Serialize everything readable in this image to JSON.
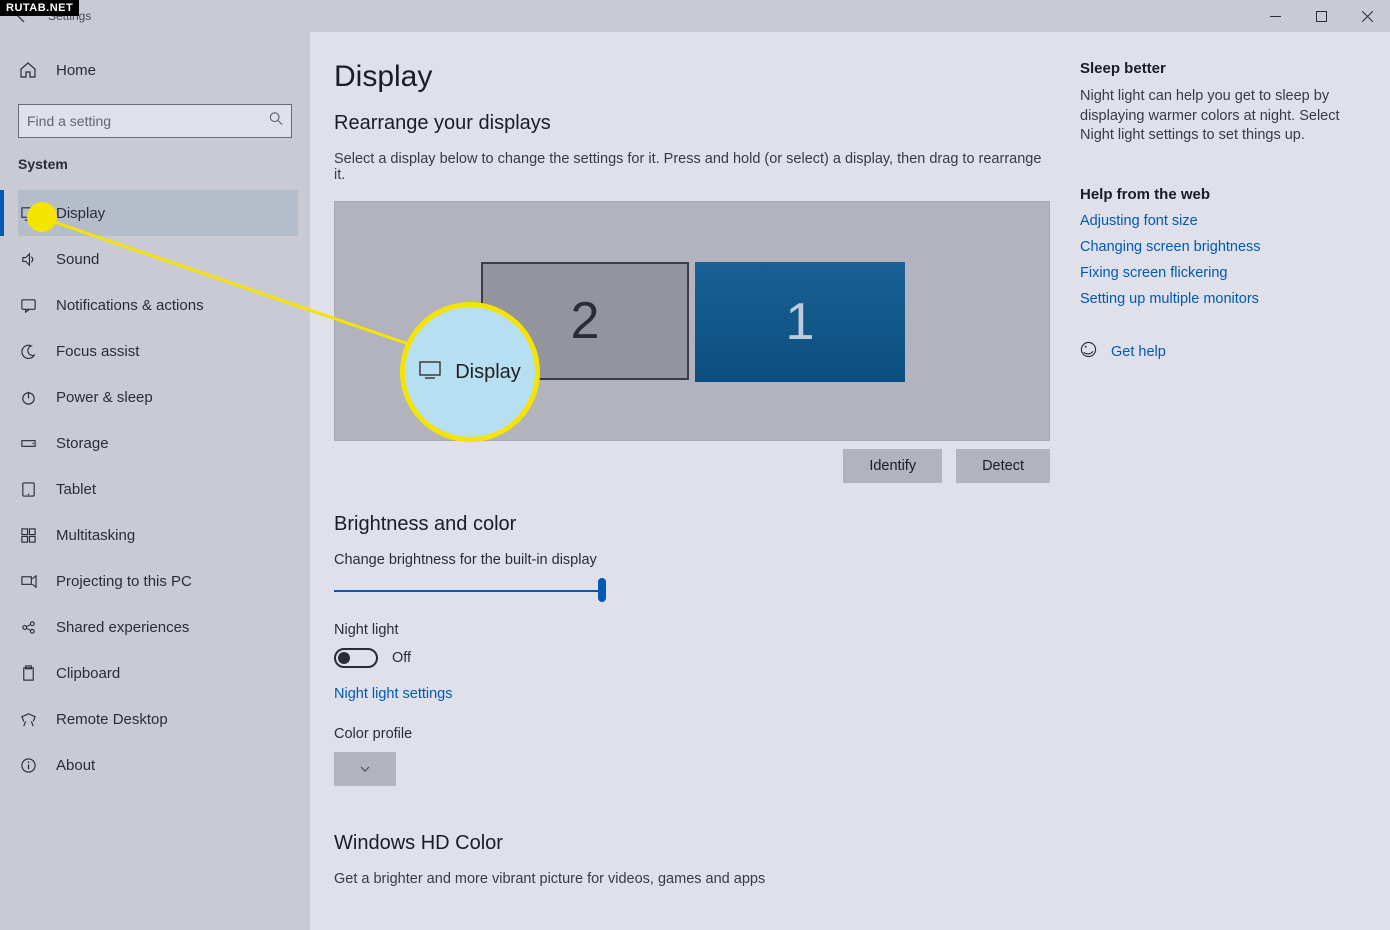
{
  "watermark": "RUTAB.NET",
  "titlebar": {
    "title": "Settings"
  },
  "sidebar": {
    "home": "Home",
    "search_placeholder": "Find a setting",
    "section": "System",
    "items": [
      {
        "label": "Display",
        "icon": "monitor",
        "active": true
      },
      {
        "label": "Sound",
        "icon": "sound"
      },
      {
        "label": "Notifications & actions",
        "icon": "chat"
      },
      {
        "label": "Focus assist",
        "icon": "moon"
      },
      {
        "label": "Power & sleep",
        "icon": "power"
      },
      {
        "label": "Storage",
        "icon": "storage"
      },
      {
        "label": "Tablet",
        "icon": "tablet"
      },
      {
        "label": "Multitasking",
        "icon": "multitask"
      },
      {
        "label": "Projecting to this PC",
        "icon": "project"
      },
      {
        "label": "Shared experiences",
        "icon": "share"
      },
      {
        "label": "Clipboard",
        "icon": "clipboard"
      },
      {
        "label": "Remote Desktop",
        "icon": "remote"
      },
      {
        "label": "About",
        "icon": "info"
      }
    ]
  },
  "main": {
    "title": "Display",
    "rearrange_h": "Rearrange your displays",
    "rearrange_desc": "Select a display below to change the settings for it. Press and hold (or select) a display, then drag to rearrange it.",
    "monitor1": "1",
    "monitor2": "2",
    "identify": "Identify",
    "detect": "Detect",
    "brightness_h": "Brightness and color",
    "brightness_label": "Change brightness for the built-in display",
    "nightlight_label": "Night light",
    "nightlight_state": "Off",
    "nightlight_link": "Night light settings",
    "colorprofile_label": "Color profile",
    "hdcolor_h": "Windows HD Color",
    "hdcolor_desc": "Get a brighter and more vibrant picture for videos, games and apps"
  },
  "right": {
    "sleep_h": "Sleep better",
    "sleep_text": "Night light can help you get to sleep by displaying warmer colors at night. Select Night light settings to set things up.",
    "help_h": "Help from the web",
    "links": [
      "Adjusting font size",
      "Changing screen brightness",
      "Fixing screen flickering",
      "Setting up multiple monitors"
    ],
    "gethelp": "Get help"
  },
  "callout": {
    "label": "Display"
  }
}
